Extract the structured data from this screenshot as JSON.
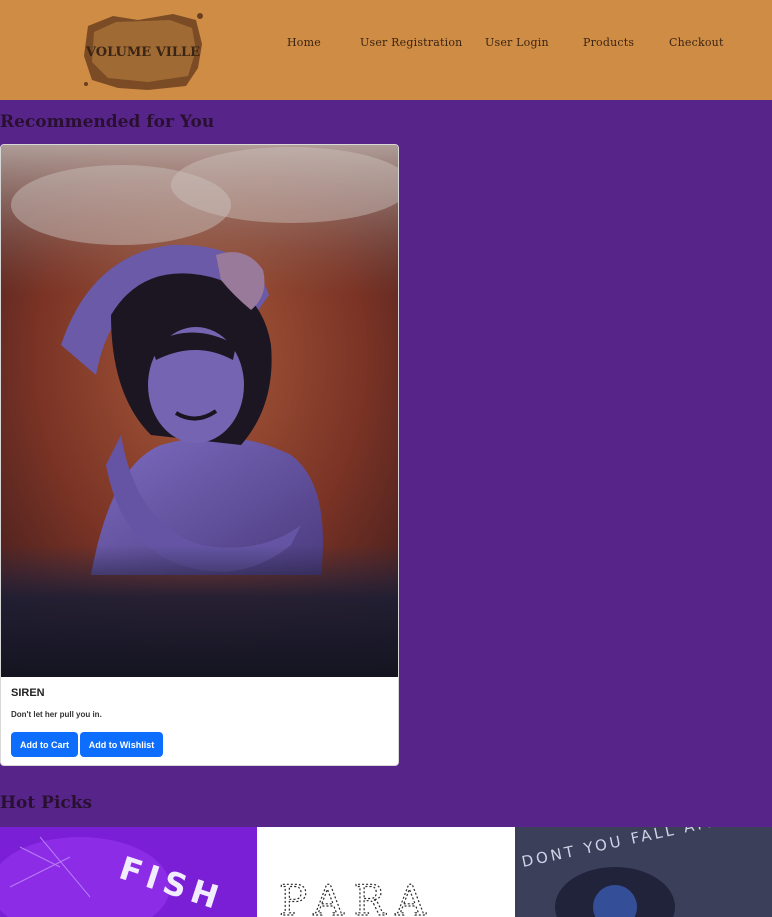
{
  "header": {
    "logo_text": "VOLUME VILLE",
    "nav": [
      {
        "label": "Home"
      },
      {
        "label": "User Registration"
      },
      {
        "label": "User Login"
      },
      {
        "label": "Products"
      },
      {
        "label": "Checkout"
      }
    ]
  },
  "recommended": {
    "heading": "Recommended for You",
    "product": {
      "title": "SIREN",
      "description": "Don't let her pull you in.",
      "add_to_cart_label": "Add to Cart",
      "add_to_wishlist_label": "Add to Wishlist"
    }
  },
  "hot_picks": {
    "heading": "Hot Picks",
    "tiles": [
      {
        "text": "FISH"
      },
      {
        "text": "PARA"
      },
      {
        "text": "DONT YOU FALL APART"
      }
    ]
  },
  "colors": {
    "header_bg": "#cf8c45",
    "page_bg": "#57258a",
    "button_bg": "#0d6efd"
  }
}
